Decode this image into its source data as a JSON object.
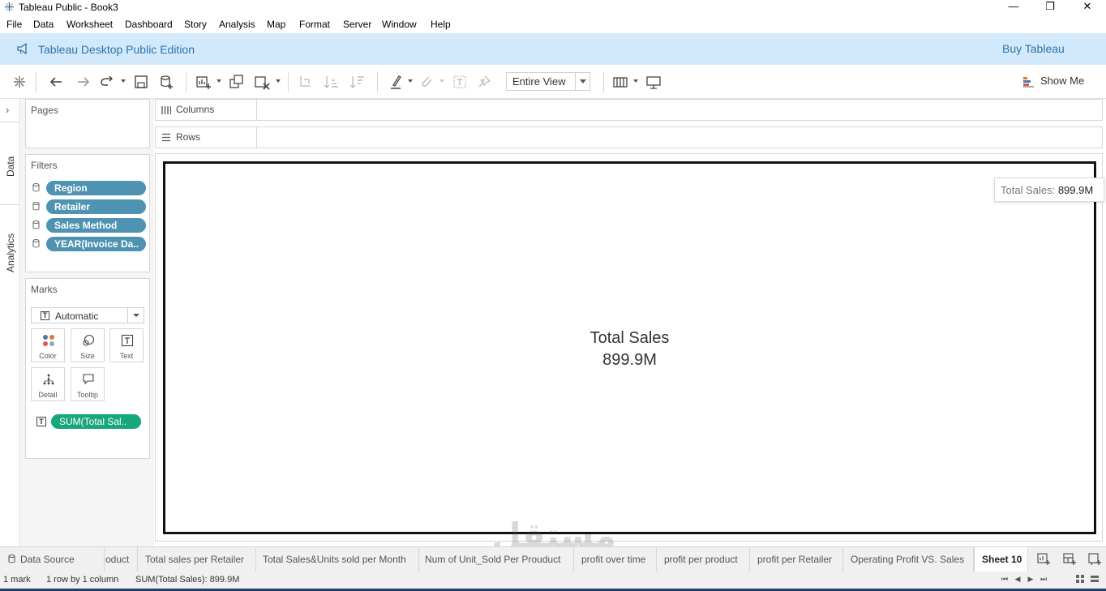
{
  "window": {
    "title": "Tableau Public - Book3",
    "controls": {
      "minimize": "—",
      "restore": "❐",
      "close": "✕"
    }
  },
  "menu": [
    "File",
    "Data",
    "Worksheet",
    "Dashboard",
    "Story",
    "Analysis",
    "Map",
    "Format",
    "Server",
    "Window",
    "Help"
  ],
  "banner": {
    "edition": "Tableau Desktop Public Edition",
    "buy": "Buy Tableau",
    "background": "#d2e9fb",
    "text_color": "#2f73a8"
  },
  "toolbar": {
    "fit": "Entire View",
    "show_me": "Show Me"
  },
  "left_rail": {
    "tabs": [
      "Data",
      "Analytics"
    ]
  },
  "pages": {
    "title": "Pages"
  },
  "filters": {
    "title": "Filters",
    "items": [
      "Region",
      "Retailer",
      "Sales Method",
      "YEAR(Invoice Da.."
    ],
    "pill_color": "#4e93b2"
  },
  "marks": {
    "title": "Marks",
    "type": "Automatic",
    "buttons": [
      "Color",
      "Size",
      "Text",
      "Detail",
      "Tooltip"
    ],
    "field": "SUM(Total Sal..",
    "field_color": "#18a77a"
  },
  "shelves": {
    "columns": "Columns",
    "rows": "Rows"
  },
  "view": {
    "kpi_title": "Total Sales",
    "kpi_value": "899.9M",
    "tooltip_key": "Total Sales:",
    "tooltip_value": "899.9M"
  },
  "watermark": {
    "arabic": "مستقل",
    "latin": "mostaql.com"
  },
  "sheet_tabs": {
    "data_source": "Data Source",
    "tabs": [
      "oduct",
      "Total sales per Retailer",
      "Total Sales&Units sold per Month",
      "Num of Unit_Sold Per Prouduct",
      "profit over time",
      "profit per product",
      "profit per Retailer",
      "Operating Profit VS. Sales",
      "Sheet 10"
    ],
    "active": "Sheet 10"
  },
  "status": {
    "marks": "1 mark",
    "dims": "1 row by 1 column",
    "sum": "SUM(Total Sales): 899.9M"
  }
}
